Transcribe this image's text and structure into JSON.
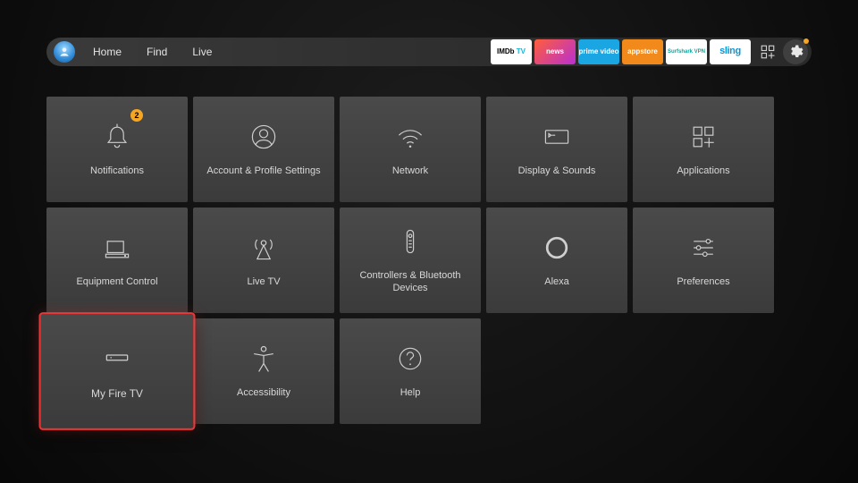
{
  "nav": {
    "links": [
      "Home",
      "Find",
      "Live"
    ]
  },
  "app_tiles": {
    "imdb": {
      "label_html": "IMDb TV",
      "l1": "IMDb",
      "l2": "TV"
    },
    "news": {
      "label": "news"
    },
    "primevideo": {
      "label": "prime video"
    },
    "appstore": {
      "label": "appstore"
    },
    "surfshark": {
      "label": "Surfshark VPN"
    },
    "sling": {
      "label": "sling"
    }
  },
  "settings_tiles": [
    {
      "id": "notifications",
      "label": "Notifications",
      "icon": "bell",
      "badge": "2"
    },
    {
      "id": "account-profile",
      "label": "Account & Profile Settings",
      "icon": "user-circle"
    },
    {
      "id": "network",
      "label": "Network",
      "icon": "wifi"
    },
    {
      "id": "display-sounds",
      "label": "Display & Sounds",
      "icon": "display"
    },
    {
      "id": "applications",
      "label": "Applications",
      "icon": "apps-plus"
    },
    {
      "id": "equipment-control",
      "label": "Equipment Control",
      "icon": "equipment"
    },
    {
      "id": "live-tv",
      "label": "Live TV",
      "icon": "antenna"
    },
    {
      "id": "controllers-bluetooth",
      "label": "Controllers & Bluetooth Devices",
      "icon": "remote"
    },
    {
      "id": "alexa",
      "label": "Alexa",
      "icon": "ring"
    },
    {
      "id": "preferences",
      "label": "Preferences",
      "icon": "sliders"
    },
    {
      "id": "my-fire-tv",
      "label": "My Fire TV",
      "icon": "firetv",
      "selected": true
    },
    {
      "id": "accessibility",
      "label": "Accessibility",
      "icon": "accessibility"
    },
    {
      "id": "help",
      "label": "Help",
      "icon": "help"
    }
  ]
}
